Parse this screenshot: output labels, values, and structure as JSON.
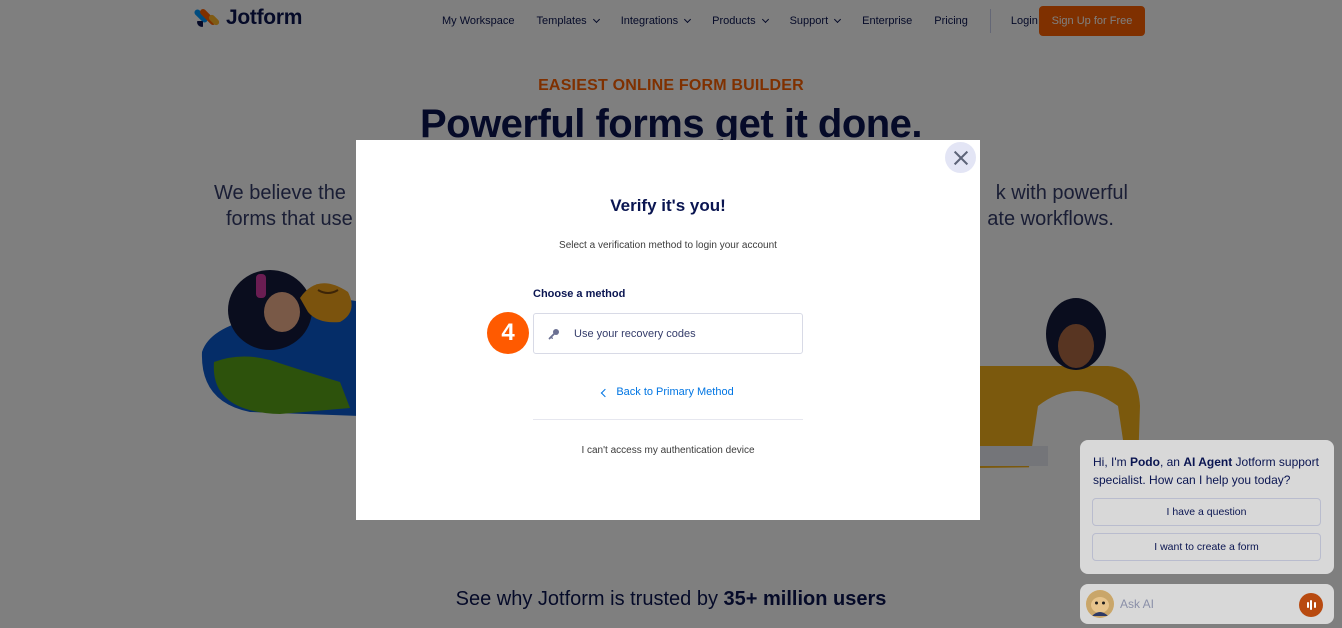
{
  "nav": {
    "logo_text": "Jotform",
    "links": [
      {
        "label": "My Workspace",
        "dropdown": false
      },
      {
        "label": "Templates",
        "dropdown": true
      },
      {
        "label": "Integrations",
        "dropdown": true
      },
      {
        "label": "Products",
        "dropdown": true
      },
      {
        "label": "Support",
        "dropdown": true
      },
      {
        "label": "Enterprise",
        "dropdown": false
      },
      {
        "label": "Pricing",
        "dropdown": false
      }
    ],
    "login": "Login",
    "signup": "Sign Up for Free"
  },
  "hero": {
    "eyebrow": "EASIEST ONLINE FORM BUILDER",
    "title": "Powerful forms get it done.",
    "subtitle_left_line1": "We believe the",
    "subtitle_left_line2": "forms that use",
    "subtitle_right_line1": "k with powerful",
    "subtitle_right_line2": "ate workflows."
  },
  "trusted": {
    "prefix": "See why Jotform is trusted by ",
    "bold": "35+ million users"
  },
  "modal": {
    "title": "Verify it's you!",
    "subtitle": "Select a verification method to login your account",
    "method_label": "Choose a method",
    "method_value": "Use your recovery codes",
    "back_link": "Back to Primary Method",
    "cant_access": "I can't access my authentication device",
    "step_number": "4"
  },
  "chat": {
    "greeting_prefix": "Hi, I'm ",
    "agent_name": "Podo",
    "greeting_mid": ", an ",
    "agent_role": "AI Agent",
    "greeting_suffix": " Jotform support specialist. How can I help you today?",
    "option_1": "I have a question",
    "option_2": "I want to create a form",
    "ask_placeholder": "Ask AI"
  },
  "colors": {
    "brand_orange": "#ff6100",
    "navy": "#0a1551",
    "link_blue": "#0075e3"
  }
}
